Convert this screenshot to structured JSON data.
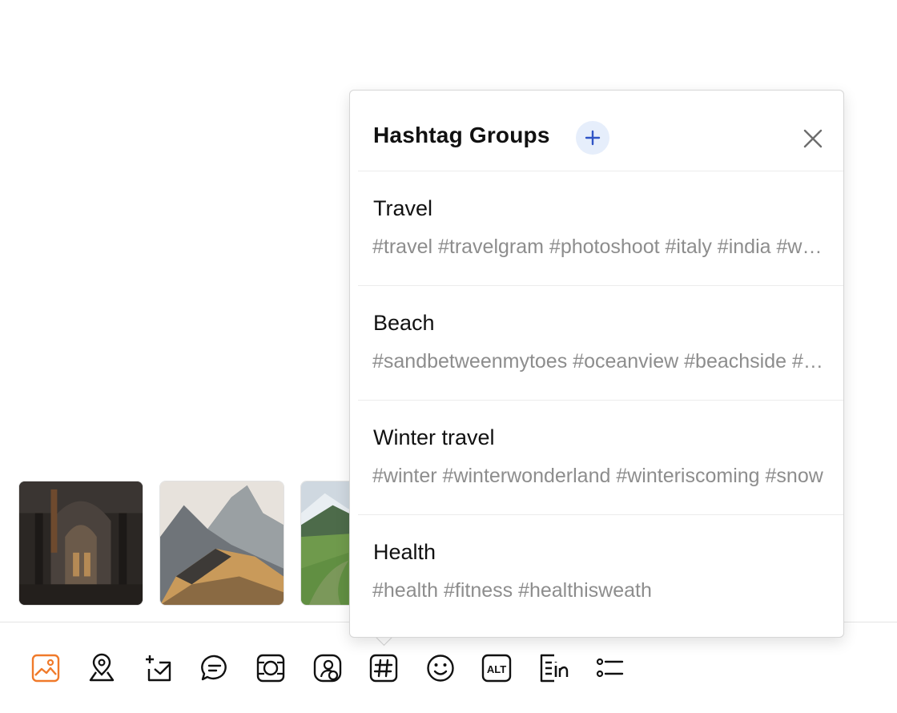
{
  "colors": {
    "accent": "#f07a2a",
    "add_button_bg": "#e6eefb",
    "add_button_icon": "#2f54c6",
    "tag_text": "#8d8d8d"
  },
  "thumbnails": [
    {
      "subject": "cathedral interior"
    },
    {
      "subject": "mountain peaks at sunset"
    },
    {
      "subject": "green valley with snowy mountains"
    }
  ],
  "toolbar": {
    "items": [
      {
        "icon": "image-icon",
        "active": true
      },
      {
        "icon": "location-pin-icon",
        "active": false
      },
      {
        "icon": "add-mail-icon",
        "active": false
      },
      {
        "icon": "chat-bubble-icon",
        "active": false
      },
      {
        "icon": "media-frame-icon",
        "active": false
      },
      {
        "icon": "tag-people-icon",
        "active": false
      },
      {
        "icon": "hashtag-icon",
        "active": false
      },
      {
        "icon": "emoji-icon",
        "active": false
      },
      {
        "icon": "alt-text-icon",
        "active": false
      },
      {
        "icon": "linkedin-text-icon",
        "active": false
      },
      {
        "icon": "checklist-icon",
        "active": false
      }
    ],
    "alt_label": "ALT"
  },
  "hashtag_popover": {
    "title": "Hashtag Groups",
    "groups": [
      {
        "name": "Travel",
        "tags": "#travel #travelgram #photoshoot #italy #india #wanderlust"
      },
      {
        "name": "Beach",
        "tags": "#sandbetweenmytoes #oceanview #beachside #summer"
      },
      {
        "name": "Winter travel",
        "tags": "#winter #winterwonderland #winteriscoming #snow"
      },
      {
        "name": "Health",
        "tags": "#health #fitness #healthisweath"
      }
    ]
  }
}
